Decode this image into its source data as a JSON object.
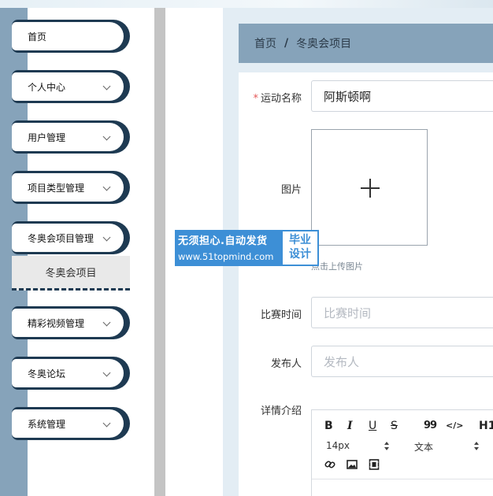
{
  "sidebar": {
    "items": [
      {
        "label": "首页",
        "has_chevron": false
      },
      {
        "label": "个人中心",
        "has_chevron": true
      },
      {
        "label": "用户管理",
        "has_chevron": true
      },
      {
        "label": "项目类型管理",
        "has_chevron": true
      },
      {
        "label": "冬奥会项目管理",
        "has_chevron": true
      },
      {
        "label": "精彩视频管理",
        "has_chevron": true
      },
      {
        "label": "冬奥论坛",
        "has_chevron": true
      },
      {
        "label": "系统管理",
        "has_chevron": true
      }
    ],
    "submenu": {
      "label": "冬奥会项目"
    }
  },
  "breadcrumb": {
    "home": "首页",
    "separator": "/",
    "current": "冬奥会项目"
  },
  "form": {
    "name": {
      "label": "运动名称",
      "required_mark": "*",
      "value": "阿斯顿啊"
    },
    "image": {
      "label": "图片",
      "hint": "点击上传图片"
    },
    "time": {
      "label": "比赛时间",
      "placeholder": "比赛时间"
    },
    "publisher": {
      "label": "发布人",
      "placeholder": "发布人"
    },
    "detail": {
      "label": "详情介绍"
    }
  },
  "editor": {
    "bold": "B",
    "italic": "I",
    "underline": "U",
    "strike": "S",
    "quote": "99",
    "code": "</>",
    "heading": "H1",
    "font_size": "14px",
    "text_style": "文本"
  },
  "watermark": {
    "line1": "无须担心.自动发货",
    "line2": "www.51topmind.com",
    "badge1": "毕业",
    "badge2": "设计"
  },
  "colors": {
    "sidebar_rail": "#86a3ba",
    "menu_border": "#1e3a52",
    "breadcrumb_bg": "#86a3ba",
    "required": "#e45656",
    "watermark": "#3d8fd6"
  }
}
